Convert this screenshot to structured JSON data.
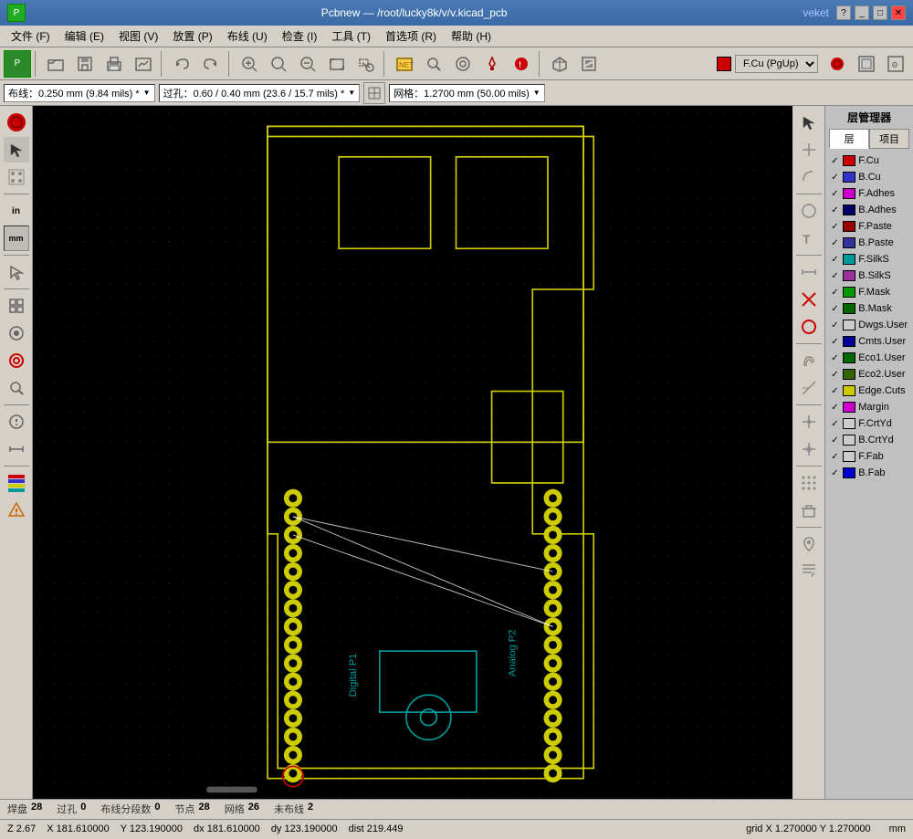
{
  "titlebar": {
    "app": "Pcbnew",
    "separator": "—",
    "file": "/root/lucky8k/v/v.kicad_pcb",
    "wm": "veket",
    "icon": "🔴"
  },
  "menubar": {
    "items": [
      {
        "label": "文件 (F)"
      },
      {
        "label": "编辑 (E)"
      },
      {
        "label": "视图 (V)"
      },
      {
        "label": "放置 (P)"
      },
      {
        "label": "布线 (U)"
      },
      {
        "label": "检查 (I)"
      },
      {
        "label": "工具 (T)"
      },
      {
        "label": "首选项 (R)"
      },
      {
        "label": "帮助 (H)"
      }
    ]
  },
  "toolbar1": {
    "layer_label": "F.Cu (PgUp)",
    "layer_color": "#cc0000"
  },
  "toolbar2": {
    "trace_label": "布线：0.250 mm (9.84 mils) *",
    "via_label": "过孔：0.60 / 0.40 mm (23.6 / 15.7 mils) *",
    "grid_label": "网格：1.2700 mm (50.00 mils)"
  },
  "layer_manager": {
    "title": "层管理器",
    "tab_layer": "层",
    "tab_project": "项目",
    "layers": [
      {
        "name": "F.Cu",
        "color": "#cc0000",
        "checked": true
      },
      {
        "name": "B.Cu",
        "color": "#3333cc",
        "checked": true
      },
      {
        "name": "F.Adhes",
        "color": "#cc00cc",
        "checked": true
      },
      {
        "name": "B.Adhes",
        "color": "#000066",
        "checked": true
      },
      {
        "name": "F.Paste",
        "color": "#990000",
        "checked": true
      },
      {
        "name": "B.Paste",
        "color": "#333399",
        "checked": true
      },
      {
        "name": "F.SilkS",
        "color": "#009999",
        "checked": true
      },
      {
        "name": "B.SilkS",
        "color": "#993399",
        "checked": true
      },
      {
        "name": "F.Mask",
        "color": "#009900",
        "checked": true
      },
      {
        "name": "B.Mask",
        "color": "#006600",
        "checked": true
      },
      {
        "name": "Dwgs.User",
        "color": "#cccccc",
        "checked": true
      },
      {
        "name": "Cmts.User",
        "color": "#000099",
        "checked": true
      },
      {
        "name": "Eco1.User",
        "color": "#006600",
        "checked": true
      },
      {
        "name": "Eco2.User",
        "color": "#336600",
        "checked": true
      },
      {
        "name": "Edge.Cuts",
        "color": "#cccc00",
        "checked": true
      },
      {
        "name": "Margin",
        "color": "#cc00cc",
        "checked": true
      },
      {
        "name": "F.CrtYd",
        "color": "#cccccc",
        "checked": true
      },
      {
        "name": "B.CrtYd",
        "color": "#cccccc",
        "checked": true
      },
      {
        "name": "F.Fab",
        "color": "#cccccc",
        "checked": true
      },
      {
        "name": "B.Fab",
        "color": "#0000cc",
        "checked": true
      }
    ]
  },
  "statusbar": {
    "row1": {
      "fields": [
        {
          "label": "焊盘",
          "value": "28"
        },
        {
          "label": "过孔",
          "value": "0"
        },
        {
          "label": "布线分段数",
          "value": "0"
        },
        {
          "label": "节点",
          "value": "28"
        },
        {
          "label": "网络",
          "value": "26"
        },
        {
          "label": "未布线",
          "value": "2"
        }
      ]
    },
    "row2": {
      "z": "Z 2.67",
      "x_label": "X",
      "x_val": "181.610000",
      "y_label": "Y",
      "y_val": "123.190000",
      "dx_label": "dx",
      "dx_val": "181.610000",
      "dy_label": "dy",
      "dy_val": "123.190000",
      "dist_label": "dist",
      "dist_val": "219.449",
      "grid_label": "grid X",
      "grid_x": "1.270000",
      "grid_y_label": "Y",
      "grid_y": "1.270000",
      "unit": "mm"
    }
  },
  "canvas": {
    "bg_color": "#000000",
    "board_outline_color": "#cccc00",
    "pad_color": "#cccc00",
    "pad_hole_color": "#000000",
    "ratsnest_color": "#ffffff",
    "label_color": "#009999",
    "component_outline": "#009999"
  }
}
